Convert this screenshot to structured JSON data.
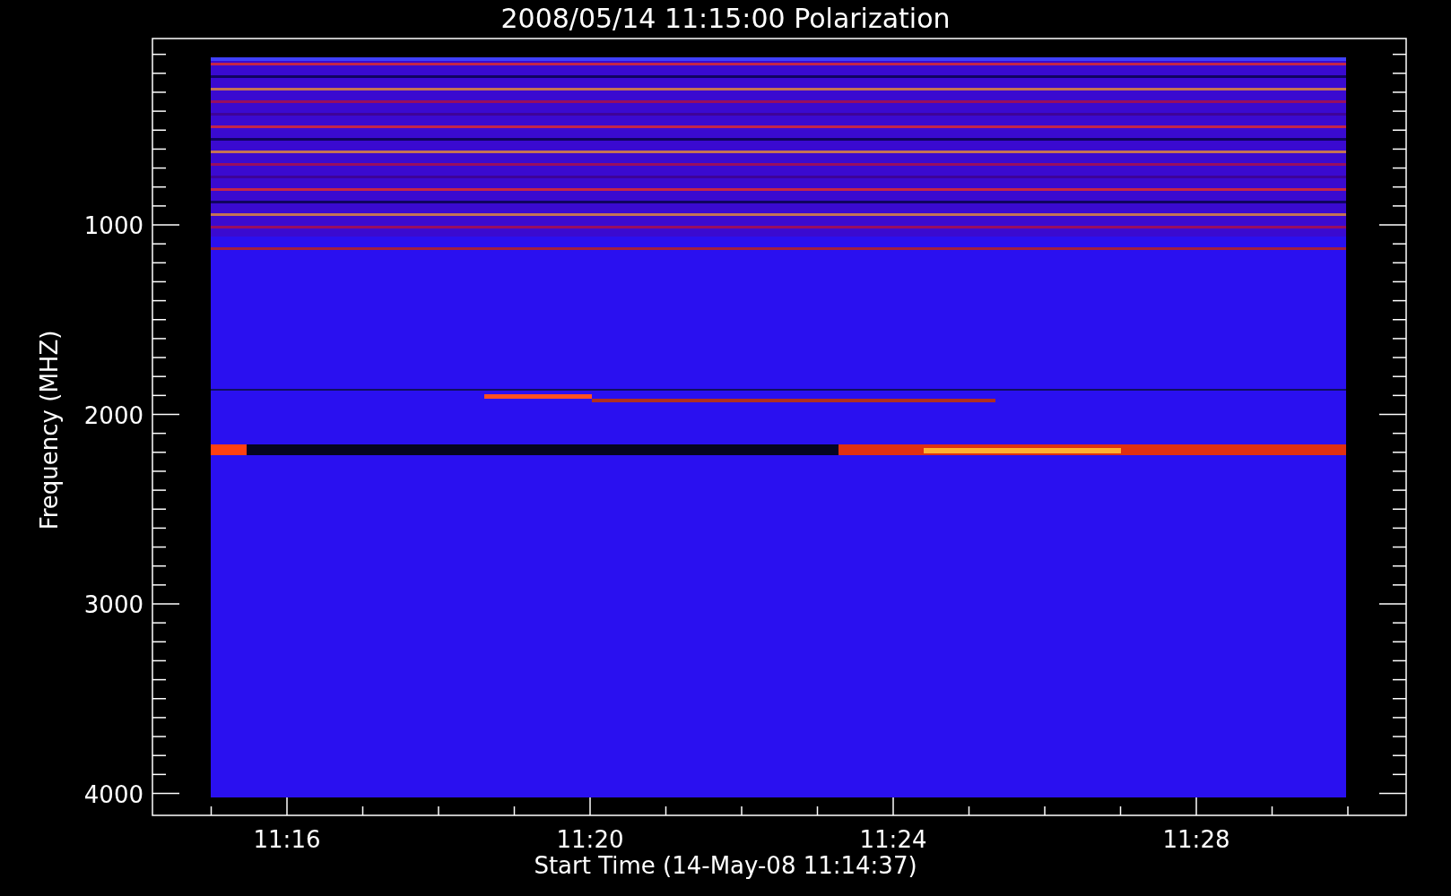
{
  "plot": {
    "title": "2008/05/14 11:15:00 Polarization",
    "ylabel": "Frequency (MHZ)",
    "xlabel": "Start Time (14-May-08 11:14:37)",
    "yticks": [
      "1000",
      "2000",
      "3000",
      "4000"
    ],
    "xticks": [
      "11:16",
      "11:20",
      "11:24",
      "11:28"
    ]
  }
}
